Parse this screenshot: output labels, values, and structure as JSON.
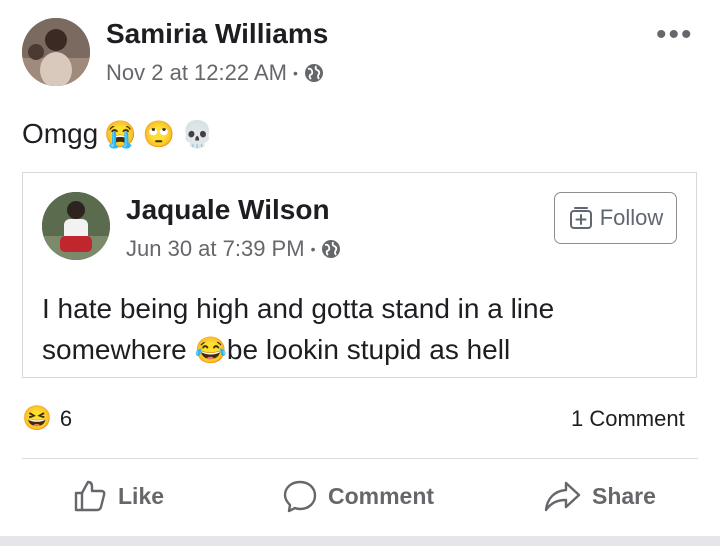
{
  "post": {
    "author": "Samiria Williams",
    "timestamp": "Nov 2 at 12:22 AM",
    "audience_separator": "•",
    "audience_icon": "globe-icon",
    "more_label": "•••",
    "text": "Omgg",
    "text_emojis": [
      "😭",
      "🙄",
      "💀"
    ]
  },
  "shared_post": {
    "author": "Jaquale Wilson",
    "timestamp": "Jun 30 at 7:39 PM",
    "audience_separator": "•",
    "audience_icon": "globe-icon",
    "follow_label": "Follow",
    "text_line1": "I hate being high and gotta stand in a line",
    "text_line2_before": "somewhere",
    "text_line2_emoji": "😂",
    "text_line2_after": "be lookin stupid as hell"
  },
  "reactions": {
    "emoji": "😆",
    "count": "6",
    "comments": "1 Comment"
  },
  "actions": {
    "like": "Like",
    "comment": "Comment",
    "share": "Share"
  },
  "colors": {
    "secondary_text": "#65676b",
    "divider": "#dadde1",
    "background": "#ffffff"
  }
}
